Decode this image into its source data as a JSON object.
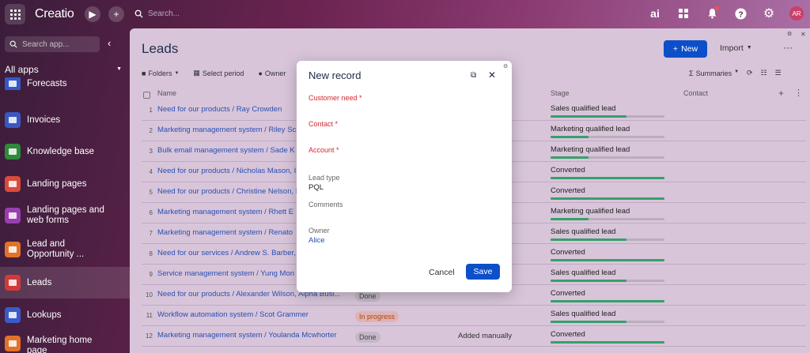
{
  "topbar": {
    "logo": "Creatio",
    "search_placeholder": "Search...",
    "avatar_initials": "AR"
  },
  "sidebar": {
    "search_placeholder": "Search app...",
    "all_apps": "All apps",
    "items": [
      {
        "label": "Forecasts",
        "color": "#3559c7"
      },
      {
        "label": "Invoices",
        "color": "#3b57c4"
      },
      {
        "label": "Knowledge base",
        "color": "#2f8a3a"
      },
      {
        "label": "Landing pages",
        "color": "#d94b3a"
      },
      {
        "label": "Landing pages and web forms",
        "color": "#9a3fb0"
      },
      {
        "label": "Lead and Opportunity ...",
        "color": "#e2722a"
      },
      {
        "label": "Leads",
        "color": "#d23a3a"
      },
      {
        "label": "Lookups",
        "color": "#3a5bc9"
      },
      {
        "label": "Marketing home page",
        "color": "#e2722a"
      }
    ]
  },
  "main": {
    "title": "Leads",
    "new_label": "New",
    "import_label": "Import",
    "toolbar": {
      "folders": "Folders",
      "select_period": "Select period",
      "owner": "Owner",
      "summaries": "Summaries"
    },
    "columns": {
      "name": "Name",
      "stage": "Stage",
      "contact": "Contact"
    },
    "rows": [
      {
        "num": "1",
        "name": "Need for our products / Ray Crowden",
        "status": "",
        "source": "",
        "stage": "Sales qualified lead",
        "progress": 0.67
      },
      {
        "num": "2",
        "name": "Marketing management system / Riley Sc",
        "status": "",
        "source": "",
        "stage": "Marketing qualified lead",
        "progress": 0.33
      },
      {
        "num": "3",
        "name": "Bulk email management system / Sade K",
        "status": "",
        "source": "",
        "stage": "Marketing qualified lead",
        "progress": 0.33
      },
      {
        "num": "4",
        "name": "Need for our products / Nicholas Mason, I",
        "status": "",
        "source": "",
        "stage": "Converted",
        "progress": 1.0
      },
      {
        "num": "5",
        "name": "Need for our products / Christine Nelson, I",
        "status": "",
        "source": "",
        "stage": "Converted",
        "progress": 1.0
      },
      {
        "num": "6",
        "name": "Marketing management system / Rhett E",
        "status": "",
        "source": "",
        "stage": "Marketing qualified lead",
        "progress": 0.33
      },
      {
        "num": "7",
        "name": "Marketing management system / Renato",
        "status": "",
        "source": "",
        "stage": "Sales qualified lead",
        "progress": 0.67
      },
      {
        "num": "8",
        "name": "Need for our services / Andrew S. Barber, /",
        "status": "",
        "source": "",
        "stage": "Converted",
        "progress": 1.0
      },
      {
        "num": "9",
        "name": "Service management system / Yung Mon",
        "status": "",
        "source": "",
        "stage": "Sales qualified lead",
        "progress": 0.67
      },
      {
        "num": "10",
        "name": "Need for our products / Alexander Wilson, Alpha Busi...",
        "status": "Done",
        "source": "",
        "stage": "Converted",
        "progress": 1.0
      },
      {
        "num": "11",
        "name": "Workflow automation system / Scot Grammer",
        "status": "In progress",
        "source": "",
        "stage": "Sales qualified lead",
        "progress": 0.67
      },
      {
        "num": "12",
        "name": "Marketing management system / Youlanda Mcwhorter",
        "status": "Done",
        "source": "Added manually",
        "stage": "Converted",
        "progress": 1.0
      }
    ]
  },
  "modal": {
    "title": "New record",
    "customer_need_label": "Customer need",
    "contact_label": "Contact",
    "account_label": "Account",
    "lead_type_label": "Lead type",
    "lead_type_value": "PQL",
    "comments_label": "Comments",
    "owner_label": "Owner",
    "owner_value": "Alice",
    "cancel_label": "Cancel",
    "save_label": "Save"
  }
}
